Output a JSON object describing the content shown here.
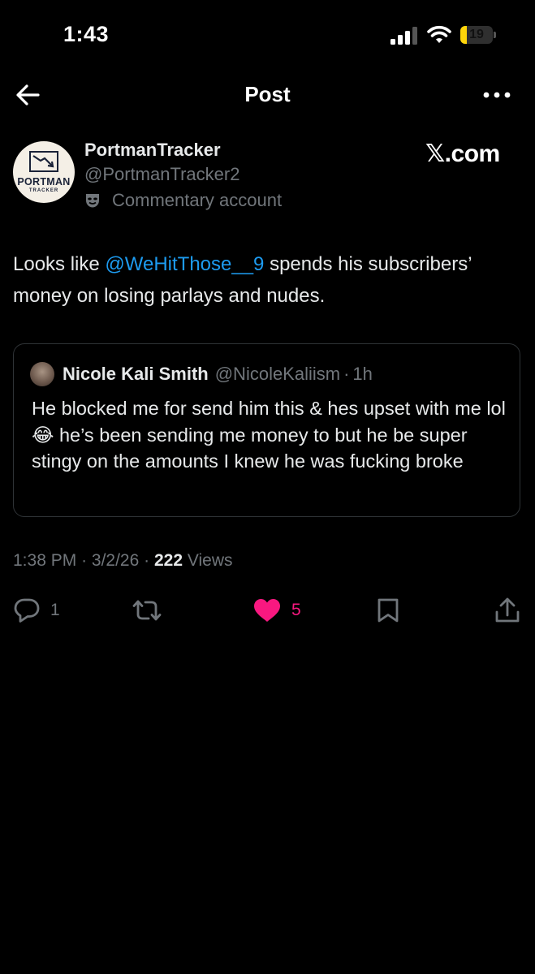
{
  "status_bar": {
    "time": "1:43",
    "battery_level": "19",
    "battery_fraction": 0.19,
    "battery_color": "#ffd60a"
  },
  "header": {
    "title": "Post",
    "back_icon": "arrow-left-icon",
    "more_icon": "ellipsis-icon"
  },
  "author": {
    "display_name": "PortmanTracker",
    "handle": "@PortmanTracker2",
    "account_label": "Commentary account",
    "account_label_icon": "mask-icon",
    "avatar_text": "PORTMAN",
    "avatar_subtext": "TRACKER"
  },
  "watermark": "𝕏.com",
  "post": {
    "text_before": "Looks like ",
    "mention": "@WeHitThose__9",
    "text_after": " spends his subscribers’ money on losing parlays and nudes."
  },
  "quote": {
    "name": "Nicole Kali Smith",
    "handle": "@NicoleKaliism",
    "separator": "·",
    "time": "1h",
    "text": "He blocked me for send him this & hes upset with me lol 😂 he’s been sending me money to but he be super stingy on the amounts I knew he was fucking broke"
  },
  "meta": {
    "time": "1:38 PM",
    "separator": "·",
    "date": "3/2/26",
    "views_count": "222",
    "views_label": "Views"
  },
  "actions": {
    "reply_count": "1",
    "like_count": "5",
    "like_color": "#f91880",
    "accent_color": "#1d9bf0"
  }
}
